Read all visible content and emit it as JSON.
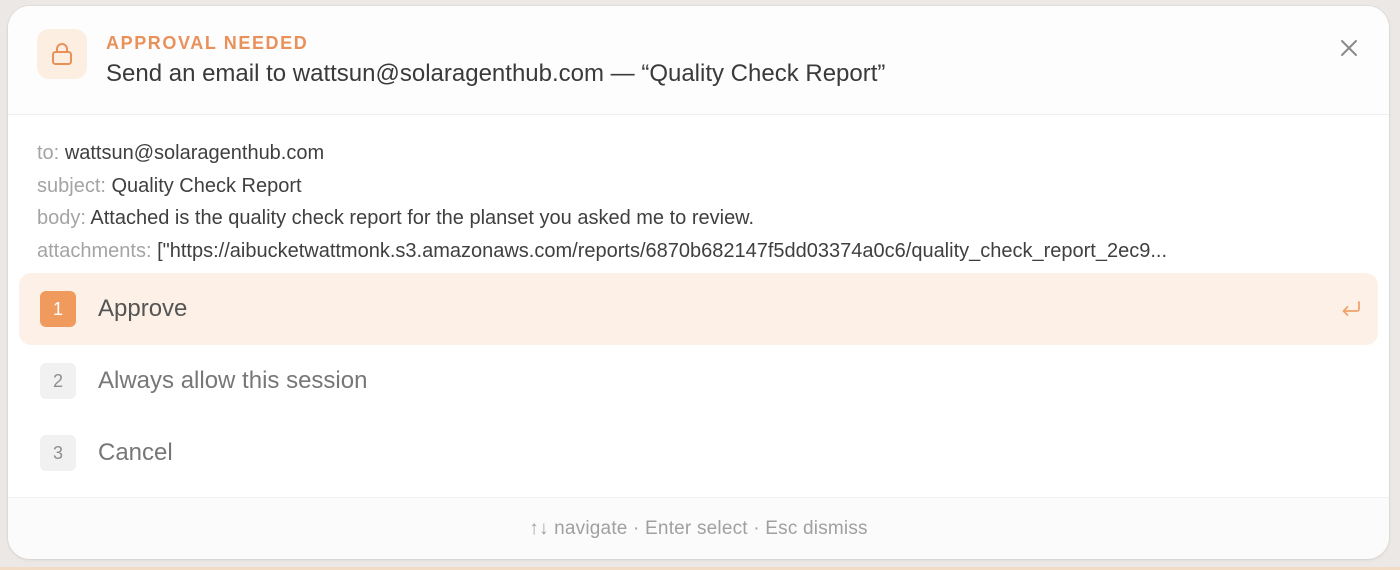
{
  "header": {
    "kicker": "APPROVAL NEEDED",
    "title": "Send an email to wattsun@solaragenthub.com — “Quality Check Report”",
    "lock_icon": "lock-icon",
    "close_icon": "close-icon"
  },
  "details": {
    "to_label": "to:",
    "to_value": "wattsun@solaragenthub.com",
    "subject_label": "subject:",
    "subject_value": "Quality Check Report",
    "body_label": "body:",
    "body_value": "Attached is the quality check report for the planset you asked me to review.",
    "attachments_label": "attachments:",
    "attachments_value": "[\"https://aibucketwattmonk.s3.amazonaws.com/reports/6870b682147f5dd03374a0c6/quality_check_report_2ec9..."
  },
  "options": [
    {
      "number": "1",
      "label": "Approve",
      "selected": true
    },
    {
      "number": "2",
      "label": "Always allow this session",
      "selected": false
    },
    {
      "number": "3",
      "label": "Cancel",
      "selected": false
    }
  ],
  "footer": {
    "hint": "↑↓ navigate · Enter select · Esc dismiss"
  },
  "colors": {
    "accent": "#e9915a",
    "accent_badge": "#f19a5e",
    "selected_bg": "#fdf1e7",
    "lock_bg": "#fdeee2"
  }
}
